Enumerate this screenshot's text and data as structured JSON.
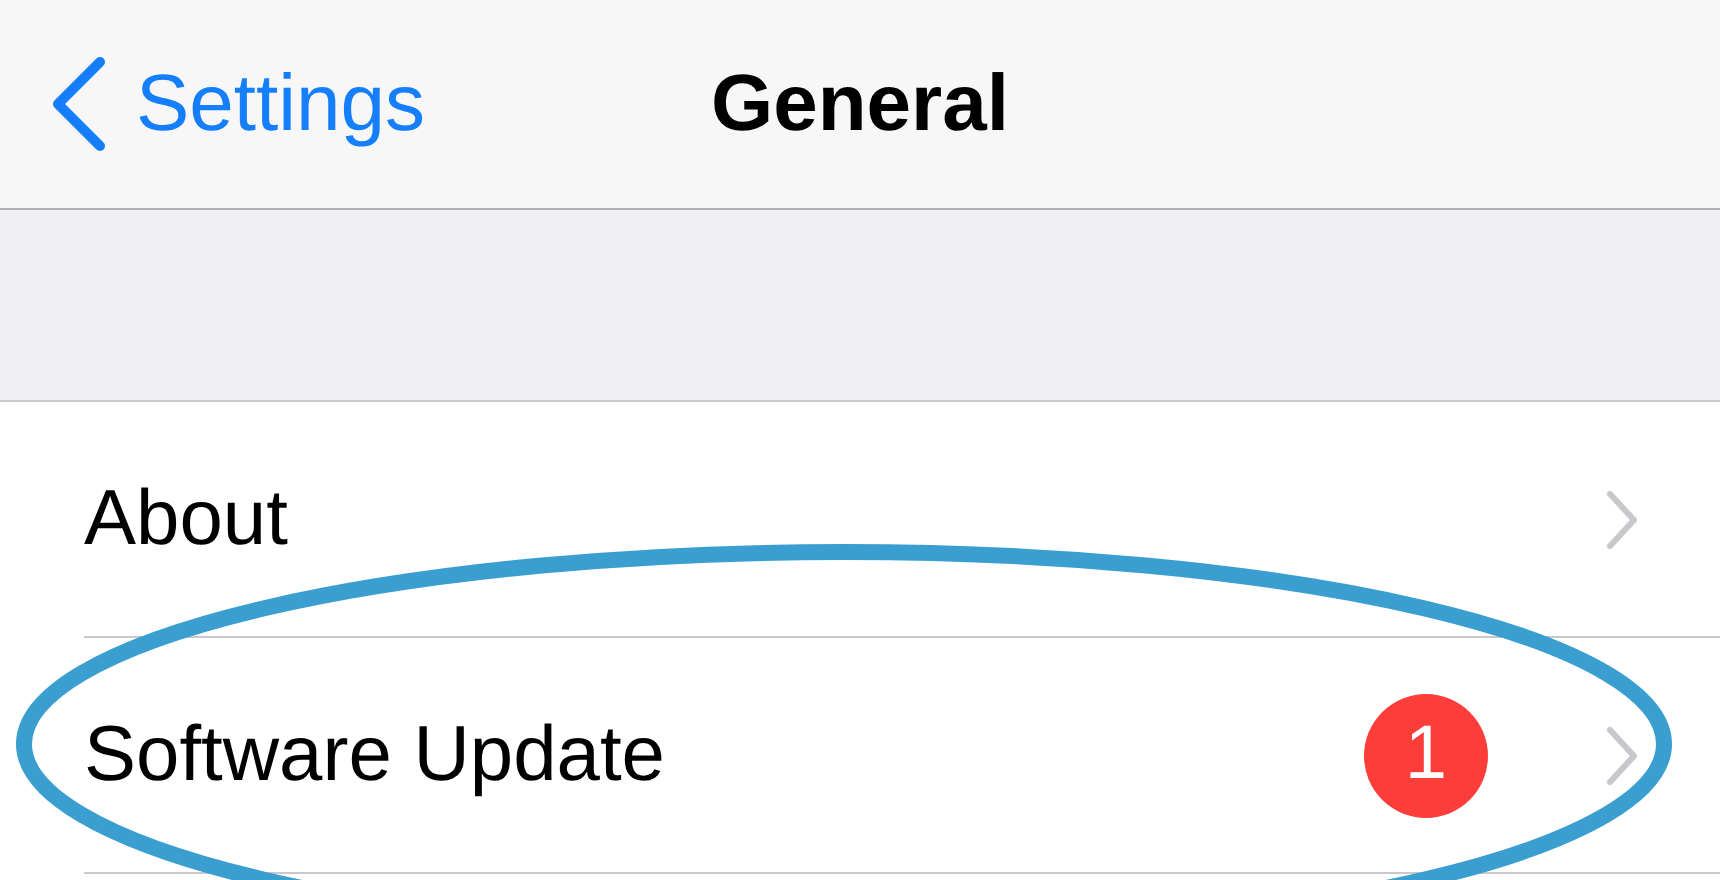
{
  "nav": {
    "back_label": "Settings",
    "title": "General"
  },
  "rows": [
    {
      "label": "About"
    },
    {
      "label": "Software Update",
      "badge": "1"
    }
  ],
  "annotation": {
    "kind": "ellipse",
    "color": "#3a9fd0"
  }
}
